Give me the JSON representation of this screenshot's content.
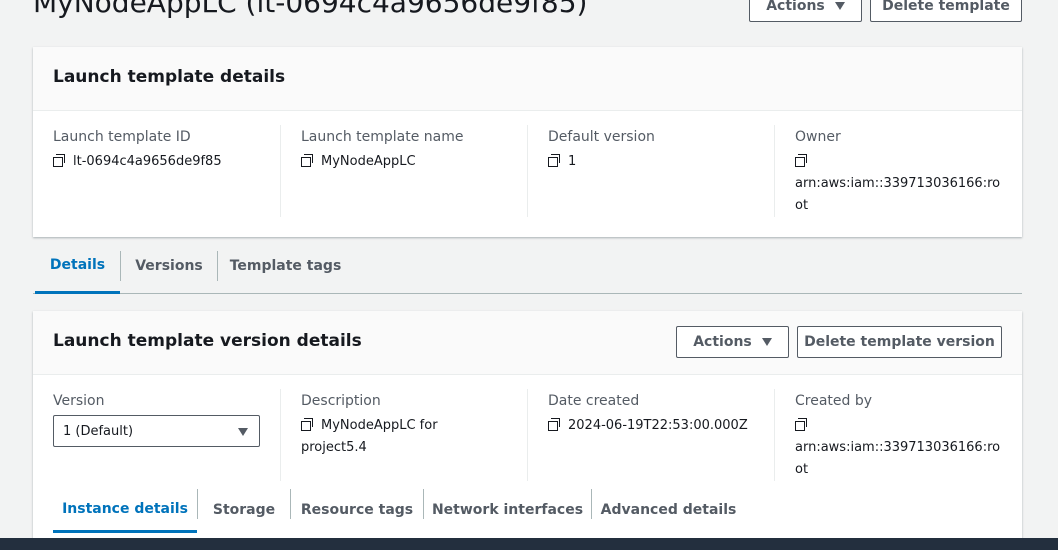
{
  "page": {
    "title": "MyNodeAppLC (lt-0694c4a9656de9f85)",
    "actions_label": "Actions",
    "delete_template_label": "Delete template"
  },
  "template_details": {
    "heading": "Launch template details",
    "fields": [
      {
        "label": "Launch template ID",
        "value": "lt-0694c4a9656de9f85"
      },
      {
        "label": "Launch template name",
        "value": "MyNodeAppLC"
      },
      {
        "label": "Default version",
        "value": "1"
      },
      {
        "label": "Owner",
        "value": "arn:aws:iam::339713036166:root"
      }
    ]
  },
  "tabs": [
    {
      "label": "Details",
      "active": true
    },
    {
      "label": "Versions",
      "active": false
    },
    {
      "label": "Template tags",
      "active": false
    }
  ],
  "version_details": {
    "heading": "Launch template version details",
    "actions_label": "Actions",
    "delete_version_label": "Delete template version",
    "version_label": "Version",
    "version_value": "1 (Default)",
    "description_label": "Description",
    "description_value": "MyNodeAppLC for project5.4",
    "date_label": "Date created",
    "date_value": "2024-06-19T22:53:00.000Z",
    "created_by_label": "Created by",
    "created_by_value": "arn:aws:iam::339713036166:root"
  },
  "subtabs": [
    {
      "label": "Instance details",
      "active": true
    },
    {
      "label": "Storage",
      "active": false
    },
    {
      "label": "Resource tags",
      "active": false
    },
    {
      "label": "Network interfaces",
      "active": false
    },
    {
      "label": "Advanced details",
      "active": false
    }
  ],
  "colors": {
    "accent": "#0073bb",
    "text": "#16191f",
    "secondary": "#545b64",
    "background": "#f2f3f3"
  }
}
